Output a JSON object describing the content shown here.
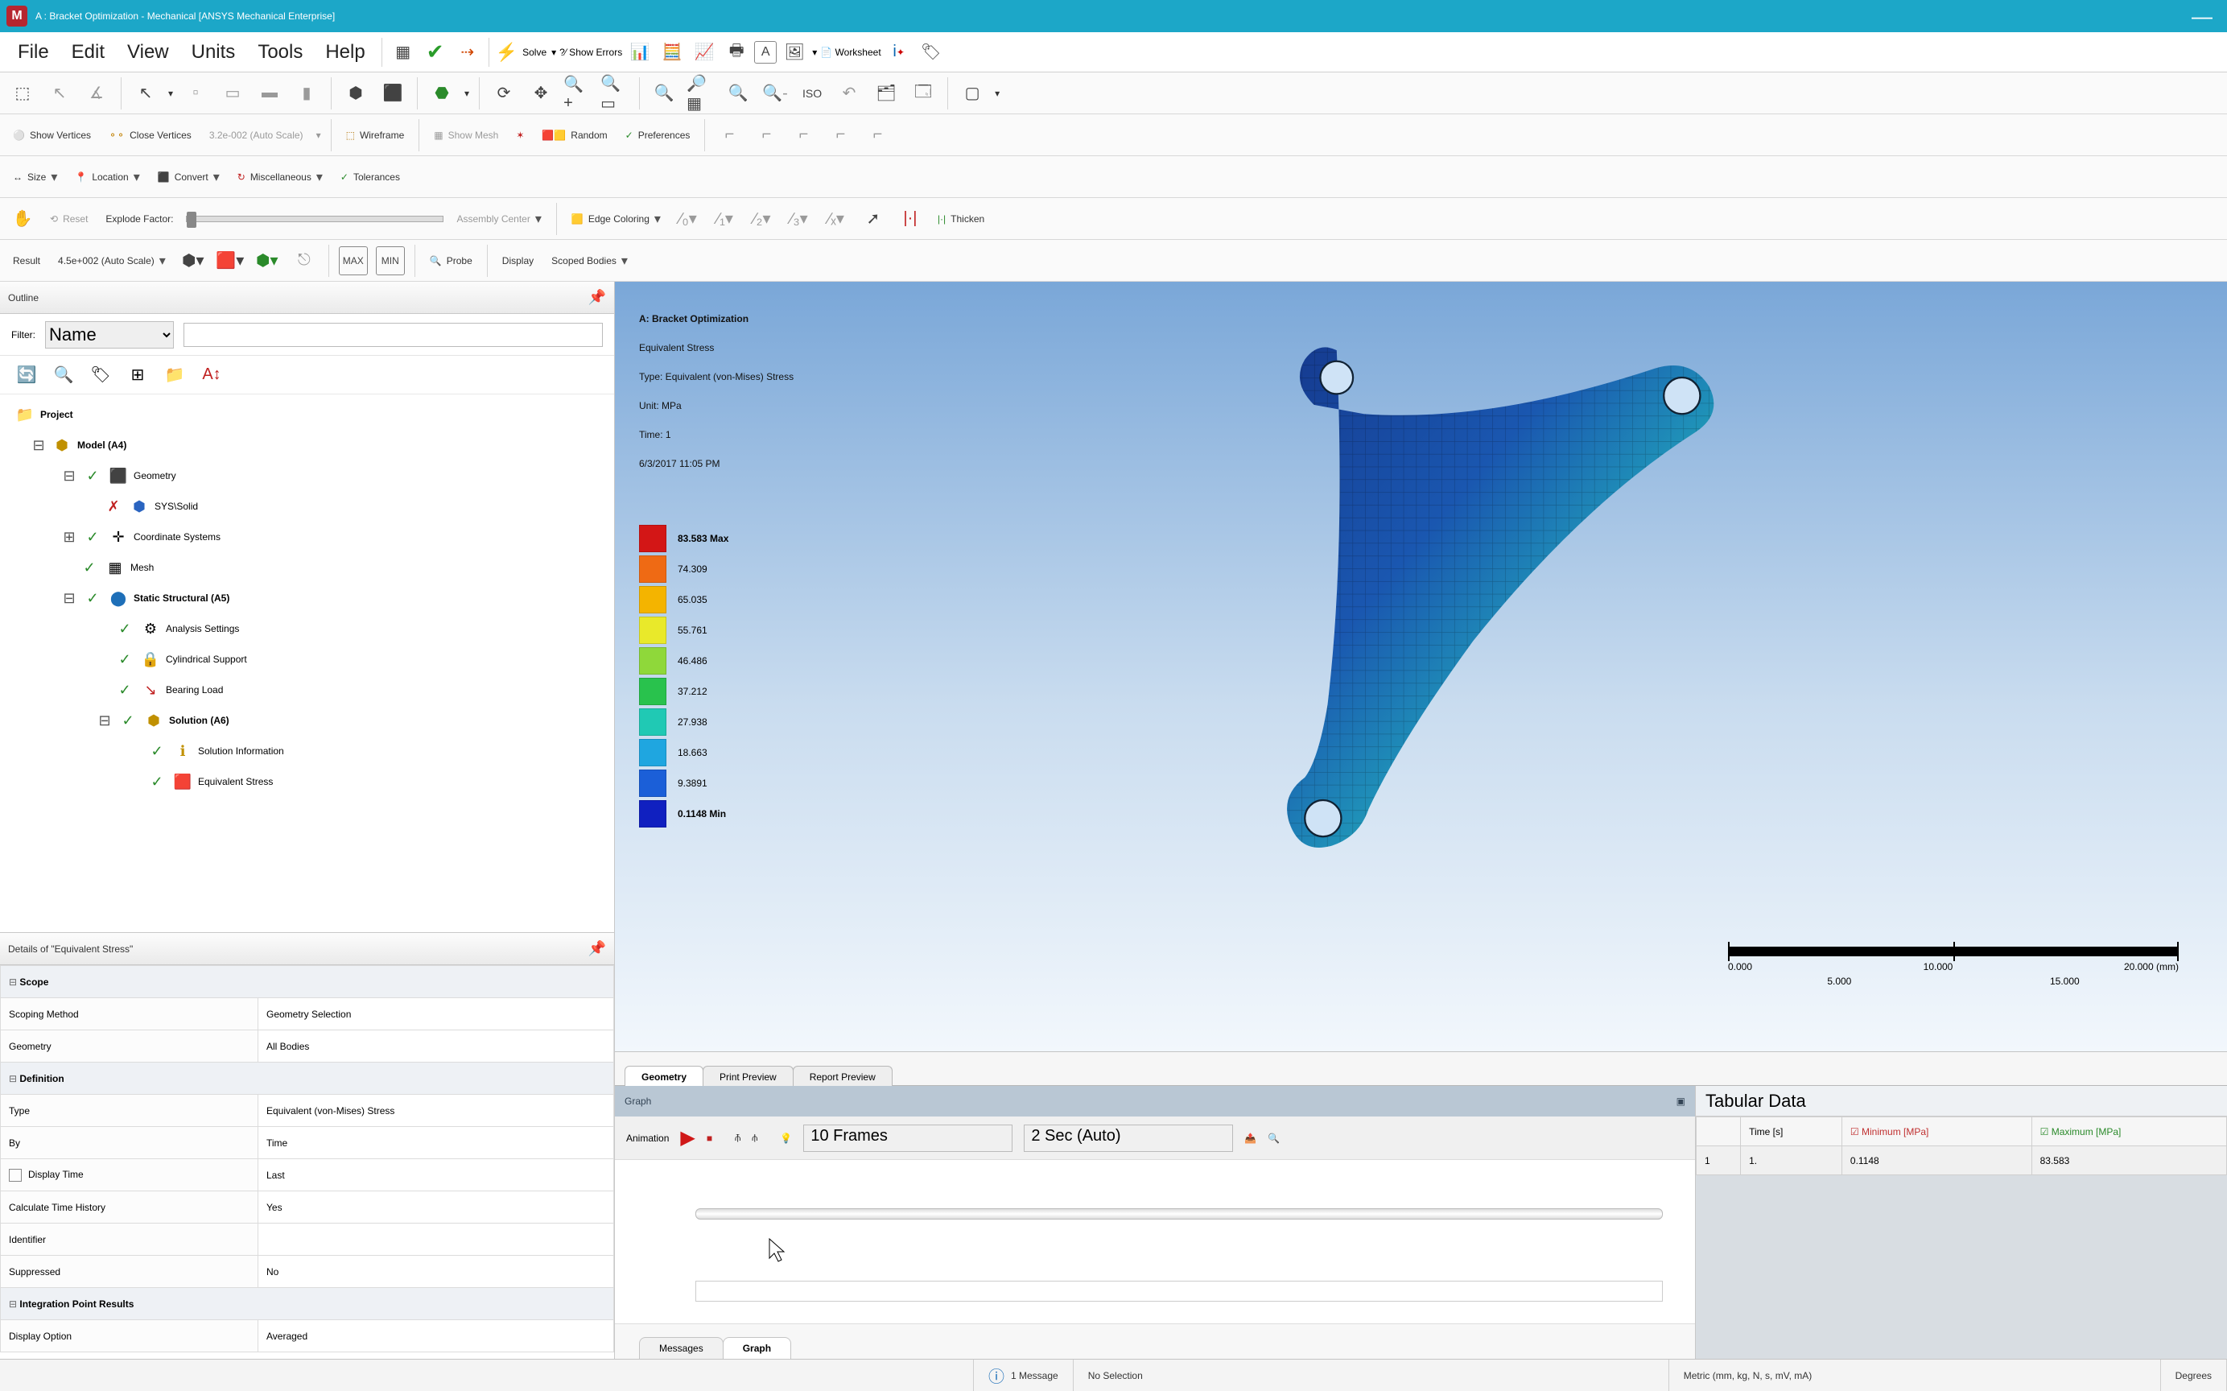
{
  "titlebar": {
    "app_icon_letter": "M",
    "text": "A : Bracket Optimization - Mechanical [ANSYS Mechanical Enterprise]"
  },
  "menubar": {
    "items": [
      "File",
      "Edit",
      "View",
      "Units",
      "Tools",
      "Help"
    ],
    "solve": "Solve",
    "show_errors": "?⁄ Show Errors",
    "worksheet": "Worksheet"
  },
  "toolbar3": {
    "show_vertices": "Show Vertices",
    "close_vertices": "Close Vertices",
    "autoscale": "3.2e-002 (Auto Scale)",
    "wireframe": "Wireframe",
    "show_mesh": "Show Mesh",
    "random": "Random",
    "preferences": "Preferences"
  },
  "toolbar4": {
    "size": "Size",
    "location": "Location",
    "convert": "Convert",
    "misc": "Miscellaneous",
    "tolerances": "Tolerances"
  },
  "toolbar5": {
    "reset": "Reset",
    "explode": "Explode Factor:",
    "assembly": "Assembly Center",
    "edge": "Edge Coloring",
    "thicken": "Thicken"
  },
  "toolbar6": {
    "result": "Result",
    "result_scale": "4.5e+002 (Auto Scale)",
    "probe": "Probe",
    "display": "Display",
    "scoped": "Scoped Bodies"
  },
  "outline": {
    "title": "Outline",
    "filter_label": "Filter:",
    "filter_value": "Name",
    "tree": {
      "project": "Project",
      "model": "Model (A4)",
      "geometry": "Geometry",
      "solid": "SYS\\Solid",
      "coord": "Coordinate Systems",
      "mesh": "Mesh",
      "static": "Static Structural (A5)",
      "analysis": "Analysis Settings",
      "cyl": "Cylindrical Support",
      "bearing": "Bearing Load",
      "solution": "Solution (A6)",
      "solinfo": "Solution Information",
      "eq": "Equivalent Stress"
    }
  },
  "details": {
    "title": "Details of \"Equivalent Stress\"",
    "rows": [
      {
        "grp": "Scope"
      },
      {
        "k": "Scoping Method",
        "v": "Geometry Selection"
      },
      {
        "k": "Geometry",
        "v": "All Bodies"
      },
      {
        "grp": "Definition"
      },
      {
        "k": "Type",
        "v": "Equivalent (von-Mises) Stress"
      },
      {
        "k": "By",
        "v": "Time"
      },
      {
        "k": "Display Time",
        "v": "Last",
        "chk": true
      },
      {
        "k": "Calculate Time History",
        "v": "Yes"
      },
      {
        "k": "Identifier",
        "v": ""
      },
      {
        "k": "Suppressed",
        "v": "No"
      },
      {
        "grp": "Integration Point Results"
      },
      {
        "k": "Display Option",
        "v": "Averaged"
      }
    ]
  },
  "viewport": {
    "header": {
      "title": "A: Bracket Optimization",
      "l1": "Equivalent Stress",
      "l2": "Type: Equivalent (von-Mises) Stress",
      "l3": "Unit: MPa",
      "l4": "Time: 1",
      "l5": "6/3/2017 11:05 PM"
    },
    "legend": [
      {
        "c": "#d31616",
        "t": "83.583 Max",
        "b": true
      },
      {
        "c": "#ef6a14",
        "t": "74.309"
      },
      {
        "c": "#f4b400",
        "t": "65.035"
      },
      {
        "c": "#e9e92a",
        "t": "55.761"
      },
      {
        "c": "#8fd83a",
        "t": "46.486"
      },
      {
        "c": "#29c24d",
        "t": "37.212"
      },
      {
        "c": "#20c9b4",
        "t": "27.938"
      },
      {
        "c": "#1fa6e0",
        "t": "18.663"
      },
      {
        "c": "#1b5fd8",
        "t": "9.3891"
      },
      {
        "c": "#1020c0",
        "t": "0.1148 Min",
        "b": true
      }
    ],
    "scale": {
      "top": [
        "0.000",
        "10.000",
        "20.000 (mm)"
      ],
      "bot": [
        "5.000",
        "15.000"
      ]
    },
    "tabs": [
      "Geometry",
      "Print Preview",
      "Report Preview"
    ]
  },
  "graph": {
    "title": "Graph",
    "anim": "Animation",
    "frames": "10 Frames",
    "time": "2 Sec (Auto)",
    "tabs": [
      "Messages",
      "Graph"
    ]
  },
  "tabular": {
    "title": "Tabular Data",
    "cols": [
      "",
      "Time [s]",
      "Minimum [MPa]",
      "Maximum [MPa]"
    ],
    "row": [
      "1",
      "1.",
      "0.1148",
      "83.583"
    ]
  },
  "status": {
    "msg": "1 Message",
    "sel": "No Selection",
    "units": "Metric (mm, kg, N, s, mV, mA)",
    "deg": "Degrees"
  },
  "chart_data": {
    "type": "table",
    "title": "Equivalent (von-Mises) Stress contour legend (MPa)",
    "unit": "MPa",
    "min": 0.1148,
    "max": 83.583,
    "levels": [
      83.583,
      74.309,
      65.035,
      55.761,
      46.486,
      37.212,
      27.938,
      18.663,
      9.3891,
      0.1148
    ],
    "colors": [
      "#d31616",
      "#ef6a14",
      "#f4b400",
      "#e9e92a",
      "#8fd83a",
      "#29c24d",
      "#20c9b4",
      "#1fa6e0",
      "#1b5fd8",
      "#1020c0"
    ],
    "scale_bar_mm": {
      "ticks_top": [
        0,
        10,
        20
      ],
      "ticks_bottom": [
        5,
        15
      ]
    },
    "time_s": 1
  }
}
